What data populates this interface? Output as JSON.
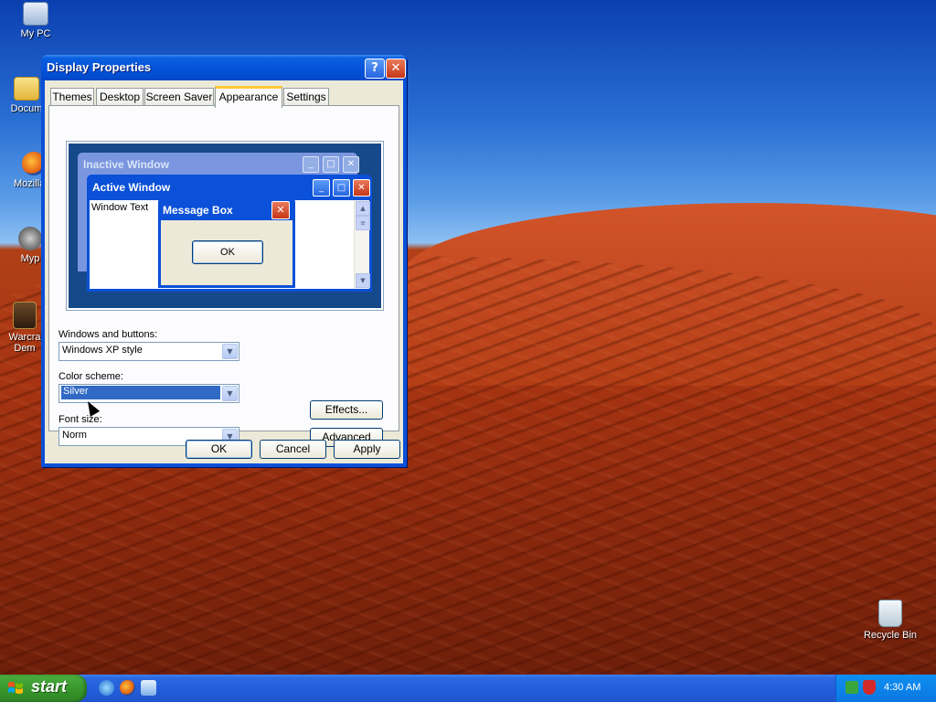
{
  "desktop": {
    "icons": [
      {
        "label": "My PC"
      },
      {
        "label": "Docum"
      },
      {
        "label": "Mozilla F"
      },
      {
        "label": "Myp"
      },
      {
        "label": "Warcra",
        "label2": "Dem"
      },
      {
        "label": "Recycle Bin"
      }
    ]
  },
  "dialog": {
    "title": "Display Properties",
    "help_glyph": "?",
    "close_glyph": "✕",
    "tabs": [
      {
        "label": "Themes"
      },
      {
        "label": "Desktop"
      },
      {
        "label": "Screen Saver"
      },
      {
        "label": "Appearance",
        "active": true
      },
      {
        "label": "Settings"
      }
    ],
    "preview": {
      "inactive_title": "Inactive Window",
      "active_title": "Active Window",
      "window_text": "Window Text",
      "message_box_title": "Message Box",
      "message_box_ok": "OK"
    },
    "windows_and_buttons": {
      "label": "Windows and buttons:",
      "value": "Windows XP style"
    },
    "color_scheme": {
      "label": "Color scheme:",
      "value": "Silver"
    },
    "font_size": {
      "label": "Font size:",
      "value": "Norm"
    },
    "effects_button": "Effects...",
    "advanced_button": "Advanced",
    "ok_button": "OK",
    "cancel_button": "Cancel",
    "apply_button": "Apply"
  },
  "taskbar": {
    "start_label": "start",
    "quick_launch": [
      "internet-explorer-icon",
      "firefox-icon",
      "messenger-icon"
    ],
    "clock": "4:30 AM"
  },
  "colors": {
    "title_blue": "#0a50d8",
    "dialog_face": "#ece9d8",
    "start_green": "#3a9a2e",
    "selection_blue": "#316ac5"
  }
}
